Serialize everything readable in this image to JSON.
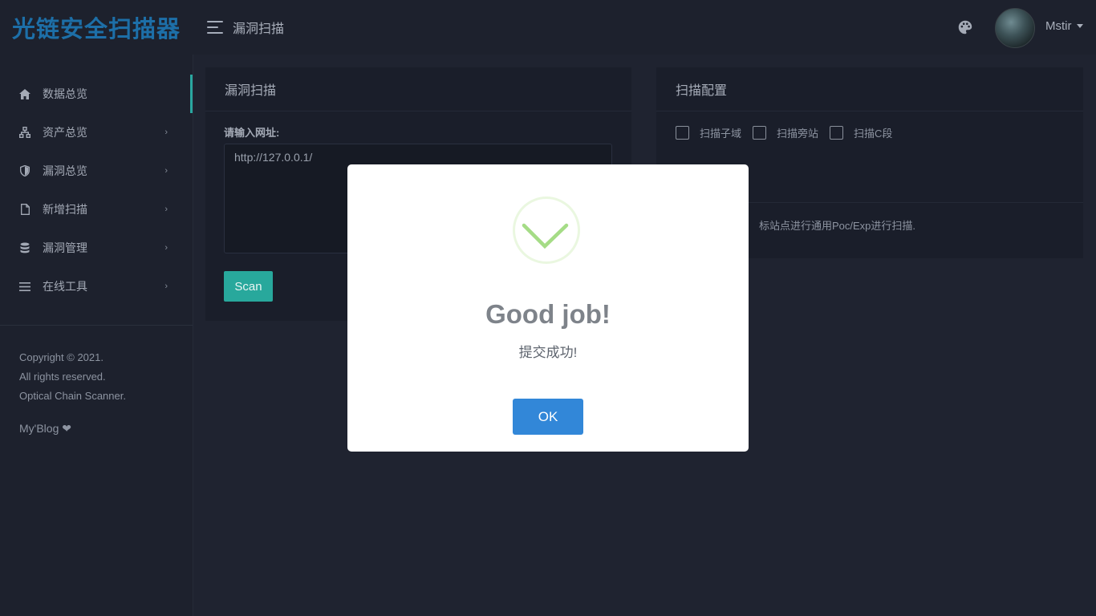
{
  "app": {
    "logo_text": "光链安全扫描器",
    "page_title": "漏洞扫描",
    "username": "Mstir",
    "accent_color": "#28a89c"
  },
  "sidebar": {
    "items": [
      {
        "label": "数据总览",
        "icon": "home-icon",
        "active": true,
        "has_submenu": false
      },
      {
        "label": "资产总览",
        "icon": "sitemap-icon",
        "active": false,
        "has_submenu": true
      },
      {
        "label": "漏洞总览",
        "icon": "shield-icon",
        "active": false,
        "has_submenu": true
      },
      {
        "label": "新增扫描",
        "icon": "file-icon",
        "active": false,
        "has_submenu": true
      },
      {
        "label": "漏洞管理",
        "icon": "database-icon",
        "active": false,
        "has_submenu": true
      },
      {
        "label": "在线工具",
        "icon": "list-icon",
        "active": false,
        "has_submenu": true
      }
    ],
    "footer": {
      "line1": "Copyright © 2021.",
      "line2": "All rights reserved.",
      "line3": "Optical Chain Scanner.",
      "blog_link": "My'Blog ❤"
    }
  },
  "scan_panel": {
    "title": "漏洞扫描",
    "input_label": "请输入网址:",
    "url_value": "http://127.0.0.1/",
    "scan_button": "Scan"
  },
  "config_panel": {
    "title": "扫描配置",
    "options": [
      {
        "label": "扫描子域",
        "checked": false
      },
      {
        "label": "扫描旁站",
        "checked": false
      },
      {
        "label": "扫描C段",
        "checked": false
      }
    ],
    "description": "标站点进行通用Poc/Exp进行扫描."
  },
  "modal": {
    "title": "Good job!",
    "text": "提交成功!",
    "ok_button": "OK",
    "icon": "success-check-icon"
  }
}
